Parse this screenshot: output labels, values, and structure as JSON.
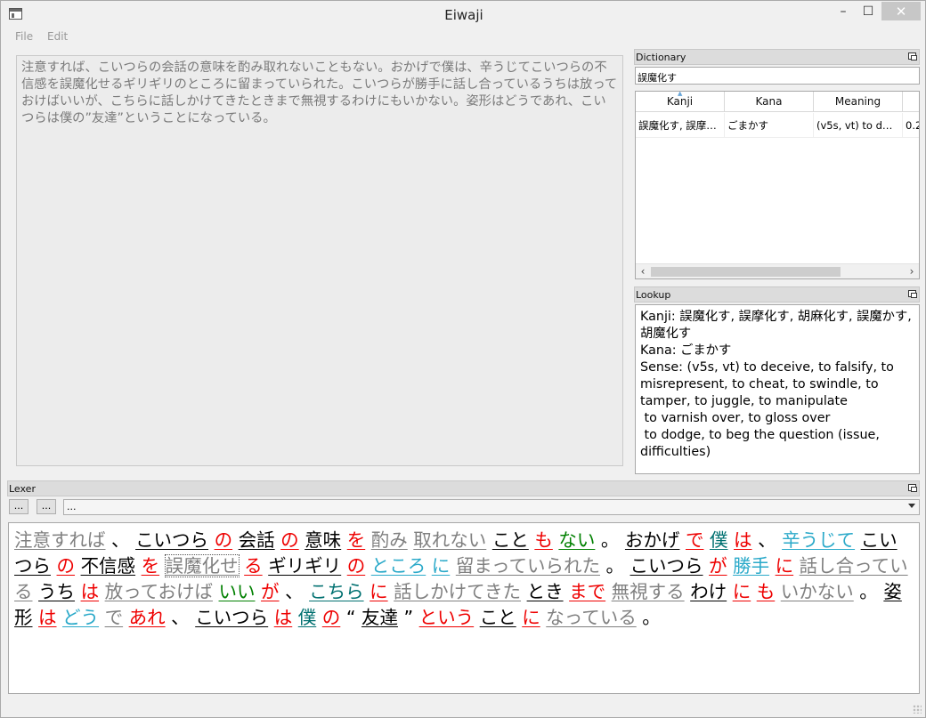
{
  "window": {
    "title": "Eiwaji"
  },
  "menu": {
    "file": "File",
    "edit": "Edit"
  },
  "editor": {
    "text": "注意すれば、こいつらの会話の意味を酌み取れないこともない。おかげで僕は、辛うじてこいつらの不信感を誤魔化せるギリギリのところに留まっていられた。こいつらが勝手に話し合っているうちは放っておけばいいが、こちらに話しかけてきたときまで無視するわけにもいかない。姿形はどうであれ、こいつらは僕の”友達”ということになっている。"
  },
  "dictionary": {
    "title": "Dictionary",
    "search_value": "誤魔化す",
    "columns": [
      "Kanji",
      "Kana",
      "Meaning",
      ""
    ],
    "rows": [
      {
        "kanji": "誤魔化す, 誤摩…",
        "kana": "ごまかす",
        "meaning": "(v5s, vt) to d…",
        "score": "0.2"
      }
    ]
  },
  "lookup": {
    "title": "Lookup",
    "text": "Kanji: 誤魔化す, 誤摩化す, 胡麻化す, 誤魔かす, 胡魔化す\nKana: ごまかす\nSense: (v5s, vt) to deceive, to falsify, to misrepresent, to cheat, to swindle, to tamper, to juggle, to manipulate\n to varnish over, to gloss over\n to dodge, to beg the question (issue, difficulties)"
  },
  "lexer": {
    "title": "Lexer",
    "button1": "...",
    "button2": "...",
    "combo_value": "...",
    "colors": {
      "black": "#000000",
      "red": "#ee0000",
      "gray": "#808080",
      "green": "#008000",
      "teal": "#007070",
      "cyan": "#2aa9c9"
    },
    "tokens": [
      {
        "t": "注意すれば",
        "c": "gray"
      },
      {
        "t": "、",
        "c": "black",
        "p": true
      },
      {
        "t": "こいつら",
        "c": "black"
      },
      {
        "t": "の",
        "c": "red"
      },
      {
        "t": "会話",
        "c": "black"
      },
      {
        "t": "の",
        "c": "red"
      },
      {
        "t": "意味",
        "c": "black"
      },
      {
        "t": "を",
        "c": "red"
      },
      {
        "t": "酌み",
        "c": "gray"
      },
      {
        "t": "取れない",
        "c": "gray"
      },
      {
        "t": "こと",
        "c": "black"
      },
      {
        "t": "も",
        "c": "red"
      },
      {
        "t": "ない",
        "c": "green"
      },
      {
        "t": "。",
        "c": "black",
        "p": true
      },
      {
        "t": "おかげ",
        "c": "black"
      },
      {
        "t": "で",
        "c": "red"
      },
      {
        "t": "僕",
        "c": "teal"
      },
      {
        "t": "は",
        "c": "red"
      },
      {
        "t": "、",
        "c": "black",
        "p": true
      },
      {
        "t": "辛うじて",
        "c": "cyan"
      },
      {
        "t": "こいつら",
        "c": "black"
      },
      {
        "t": "の",
        "c": "red"
      },
      {
        "t": "不信感",
        "c": "black"
      },
      {
        "t": "を",
        "c": "red"
      },
      {
        "t": "誤魔化せ",
        "c": "gray",
        "sel": true
      },
      {
        "t": "る",
        "c": "red"
      },
      {
        "t": "ギリギリ",
        "c": "black"
      },
      {
        "t": "の",
        "c": "red"
      },
      {
        "t": "ところ",
        "c": "cyan"
      },
      {
        "t": "に",
        "c": "cyan"
      },
      {
        "t": "留まっていられた",
        "c": "gray"
      },
      {
        "t": "。",
        "c": "black",
        "p": true
      },
      {
        "t": "こいつら",
        "c": "black"
      },
      {
        "t": "が",
        "c": "red"
      },
      {
        "t": "勝手",
        "c": "cyan"
      },
      {
        "t": "に",
        "c": "red"
      },
      {
        "t": "話し合っている",
        "c": "gray"
      },
      {
        "t": "うち",
        "c": "black"
      },
      {
        "t": "は",
        "c": "red"
      },
      {
        "t": "放っておけば",
        "c": "gray"
      },
      {
        "t": "いい",
        "c": "green"
      },
      {
        "t": "が",
        "c": "red"
      },
      {
        "t": "、",
        "c": "black",
        "p": true
      },
      {
        "t": "こちら",
        "c": "teal"
      },
      {
        "t": "に",
        "c": "red"
      },
      {
        "t": "話しかけてきた",
        "c": "gray"
      },
      {
        "t": "とき",
        "c": "black"
      },
      {
        "t": "まで",
        "c": "red"
      },
      {
        "t": "無視する",
        "c": "gray"
      },
      {
        "t": "わけ",
        "c": "black"
      },
      {
        "t": "に",
        "c": "red"
      },
      {
        "t": "も",
        "c": "red"
      },
      {
        "t": "いかない",
        "c": "gray"
      },
      {
        "t": "。",
        "c": "black",
        "p": true
      },
      {
        "t": "姿形",
        "c": "black"
      },
      {
        "t": "は",
        "c": "red"
      },
      {
        "t": "どう",
        "c": "cyan"
      },
      {
        "t": "で",
        "c": "gray"
      },
      {
        "t": "あれ",
        "c": "red"
      },
      {
        "t": "、",
        "c": "black",
        "p": true
      },
      {
        "t": "こいつら",
        "c": "black"
      },
      {
        "t": "は",
        "c": "red"
      },
      {
        "t": "僕",
        "c": "teal"
      },
      {
        "t": "の",
        "c": "red"
      },
      {
        "t": "“",
        "c": "black",
        "p": true
      },
      {
        "t": "友達",
        "c": "black"
      },
      {
        "t": "”",
        "c": "black",
        "p": true
      },
      {
        "t": "という",
        "c": "red"
      },
      {
        "t": "こと",
        "c": "black"
      },
      {
        "t": "に",
        "c": "red"
      },
      {
        "t": "なっている",
        "c": "gray"
      },
      {
        "t": "。",
        "c": "black",
        "p": true
      }
    ]
  }
}
